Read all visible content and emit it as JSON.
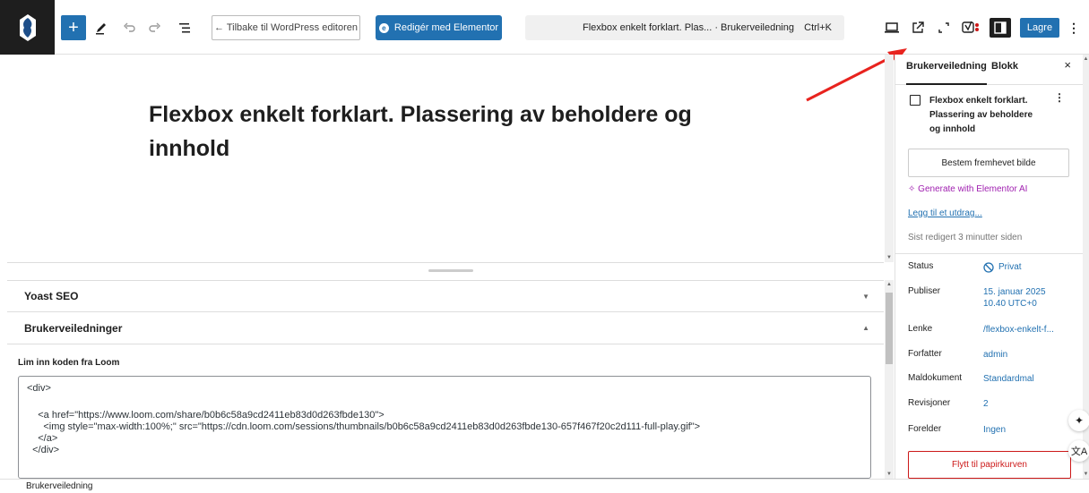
{
  "toolbar": {
    "add_label": "+",
    "back_label": "← Tilbake til WordPress editoren",
    "elementor_label": "Redigér med Elementor",
    "command_title": "Flexbox enkelt forklart. Plas... · Brukerveiledning",
    "command_shortcut": "Ctrl+K",
    "save_label": "Lagre",
    "accent": "#2271b1"
  },
  "editor": {
    "post_title": "Flexbox enkelt forklart.  Plassering av beholdere og innhold"
  },
  "metaboxes": {
    "yoast": "Yoast SEO",
    "guides": "Brukerveiledninger",
    "field_label": "Lim inn koden fra Loom",
    "code_lines": [
      "<div>",
      "",
      "    <a href=\"https://www.loom.com/share/b0b6c58a9cd2411eb83d0d263fbde130\">",
      "      <img style=\"max-width:100%;\" src=\"https://cdn.loom.com/sessions/thumbnails/b0b6c58a9cd2411eb83d0d263fbde130-657f467f20c2d111-full-play.gif\">",
      "    </a>",
      "  </div>"
    ]
  },
  "footer": {
    "breadcrumb": "Brukerveiledning"
  },
  "sidebar": {
    "tab_document": "Brukerveiledning",
    "tab_block": "Blokk",
    "close": "×",
    "post_title": "Flexbox enkelt forklart. Plassering av beholdere og innhold",
    "featured_image_button": "Bestem fremhevet bilde",
    "ai_link": "Generate with Elementor AI",
    "excerpt_link": "Legg til et utdrag...",
    "last_edited": "Sist redigert 3 minutter siden",
    "summary": [
      {
        "key": "Status",
        "value": "Privat"
      },
      {
        "key": "Publiser",
        "value": "15. januar 2025 10.40 UTC+0"
      },
      {
        "key": "Lenke",
        "value": "/flexbox-enkelt-f..."
      },
      {
        "key": "Forfatter",
        "value": "admin"
      },
      {
        "key": "Maldokument",
        "value": "Standardmal"
      },
      {
        "key": "Revisjoner",
        "value": "2"
      },
      {
        "key": "Forelder",
        "value": "Ingen"
      }
    ],
    "trash_button": "Flytt til papirkurven"
  },
  "icons": {
    "logo": "site-logo-icon",
    "tools": "pencil-icon",
    "undo": "undo-icon",
    "redo": "redo-icon",
    "list_view": "list-view-icon",
    "preview": "desktop-preview-icon",
    "view_post": "external-link-icon",
    "fullscreen": "fullscreen-icon",
    "yoast": "yoast-icon",
    "sidebar": "sidebar-toggle-icon",
    "options": "kebab-icon"
  }
}
